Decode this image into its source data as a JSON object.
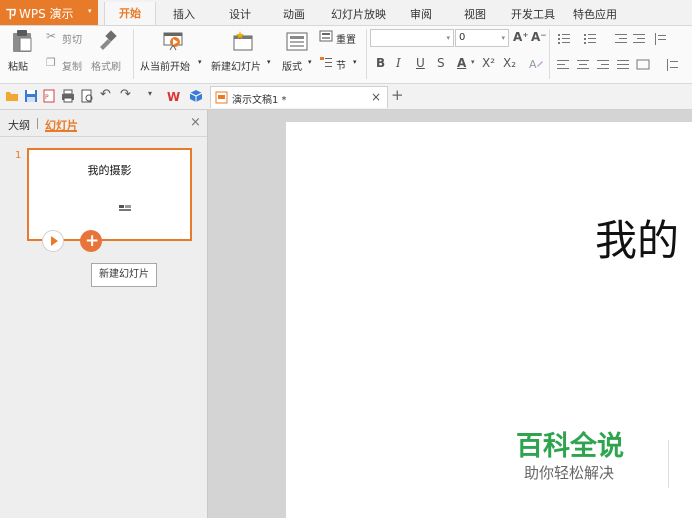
{
  "app": {
    "logo": "ㄗ",
    "name": "WPS 演示",
    "caret": "▾"
  },
  "menu_tabs": [
    "开始",
    "插入",
    "设计",
    "动画",
    "幻灯片放映",
    "审阅",
    "视图",
    "开发工具",
    "特色应用"
  ],
  "ribbon": {
    "paste": "粘贴",
    "cut": "剪切",
    "copy": "复制",
    "format_painter": "格式刷",
    "from_current": "从当前开始",
    "new_slide": "新建幻灯片",
    "layout": "版式",
    "reset": "重置",
    "section": "节",
    "font_size": "0",
    "bold": "B",
    "italic": "I",
    "underline": "U",
    "strike": "S",
    "font_color": "A",
    "superscript": "X²",
    "subscript": "X₂",
    "grow_font": "A⁺",
    "shrink_font": "A⁻"
  },
  "doc_tab": {
    "title": "演示文稿1 *",
    "close": "×",
    "new_tab": "+"
  },
  "pane": {
    "tab_outline": "大纲",
    "tab_slides": "幻灯片",
    "close": "×"
  },
  "slide_thumb": {
    "number": "1",
    "title": "我的摄影"
  },
  "tooltip": "新建幻灯片",
  "slide": {
    "title": "我的"
  },
  "watermark": {
    "brand": "百科全说",
    "tagline": "助你轻松解决"
  },
  "colors": {
    "accent": "#e87b2a",
    "watermark_green": "#2ea44f"
  }
}
